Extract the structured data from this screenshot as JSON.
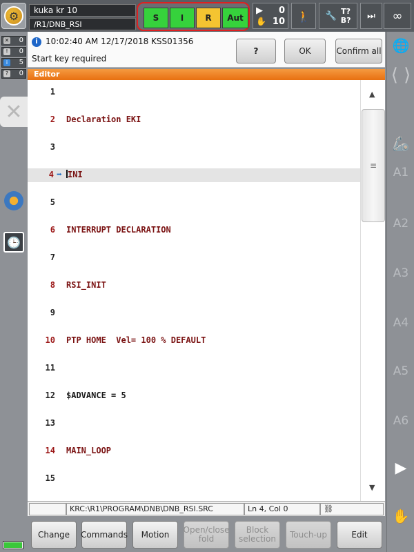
{
  "header": {
    "robot_name": "kuka kr 10",
    "program_path": "/R1/DNB_RSI",
    "status_buttons": [
      {
        "label": "S",
        "color": "#36d23c"
      },
      {
        "label": "I",
        "color": "#36d23c"
      },
      {
        "label": "R",
        "color": "#f4c431"
      },
      {
        "label": "Aut",
        "color": "#36d23c"
      }
    ],
    "override_program": "0",
    "override_jog": "10",
    "tool_base": "T?\nB?",
    "increment": "∞"
  },
  "messages": {
    "counters": [
      "0",
      "0",
      "5",
      "0"
    ],
    "header": "10:02:40 AM 12/17/2018 KSS01356",
    "text": "Start key required",
    "help_label": "?",
    "ok_label": "OK",
    "confirm_all_label": "Confirm all"
  },
  "editor": {
    "title": "Editor",
    "lines": [
      {
        "num": "1",
        "text": ""
      },
      {
        "num": "2",
        "text": "Declaration EKI"
      },
      {
        "num": "3",
        "text": ""
      },
      {
        "num": "4",
        "text": "INI"
      },
      {
        "num": "5",
        "text": ""
      },
      {
        "num": "6",
        "text": "INTERRUPT DECLARATION"
      },
      {
        "num": "7",
        "text": ""
      },
      {
        "num": "8",
        "text": "RSI_INIT"
      },
      {
        "num": "9",
        "text": ""
      },
      {
        "num": "10",
        "text": "PTP HOME  Vel= 100 % DEFAULT"
      },
      {
        "num": "11",
        "text": ""
      },
      {
        "num": "12",
        "text": "$ADVANCE = 5"
      },
      {
        "num": "13",
        "text": ""
      },
      {
        "num": "14",
        "text": "MAIN_LOOP"
      },
      {
        "num": "15",
        "text": ""
      }
    ]
  },
  "statusbar": {
    "file": "KRC:\\R1\\PROGRAM\\DNB\\DNB_RSI.SRC",
    "position": "Ln 4, Col 0"
  },
  "softkeys": [
    {
      "label": "Change",
      "enabled": true
    },
    {
      "label": "Commands",
      "enabled": true
    },
    {
      "label": "Motion",
      "enabled": true
    },
    {
      "label": "Open/close\nfold",
      "enabled": false
    },
    {
      "label": "Block\nselection",
      "enabled": false
    },
    {
      "label": "Touch-up",
      "enabled": false
    },
    {
      "label": "Edit",
      "enabled": true
    }
  ],
  "axes": [
    "A1",
    "A2",
    "A3",
    "A4",
    "A5",
    "A6"
  ]
}
